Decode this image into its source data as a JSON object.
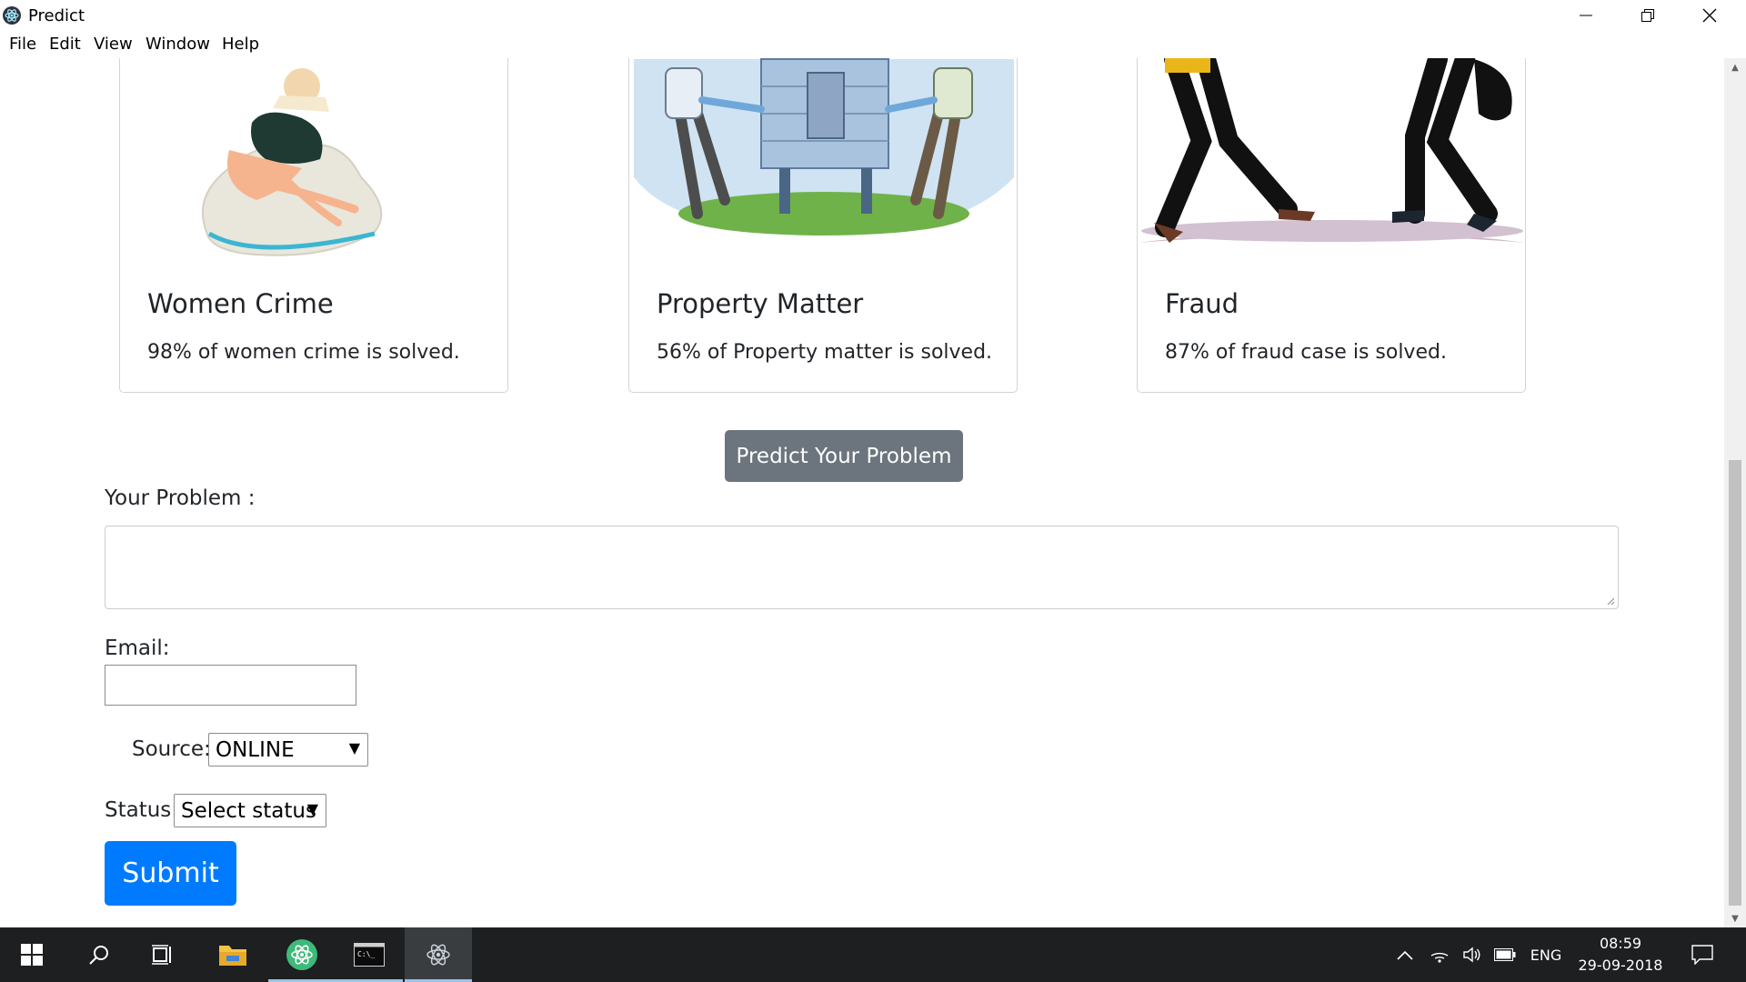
{
  "window": {
    "title": "Predict",
    "menu": [
      "File",
      "Edit",
      "View",
      "Window",
      "Help"
    ]
  },
  "cards": [
    {
      "title": "Women Crime",
      "text": "98% of women crime is solved."
    },
    {
      "title": "Property Matter",
      "text": "56% of Property matter is solved."
    },
    {
      "title": "Fraud",
      "text": "87% of fraud case is solved."
    }
  ],
  "predict_button": "Predict Your Problem",
  "form": {
    "problem_label": "Your Problem :",
    "problem_value": "",
    "email_label": "Email:",
    "email_value": "",
    "source_label": "Source:",
    "source_value": "ONLINE",
    "status_label": "Status:",
    "status_value": "Select status",
    "submit_label": "Submit"
  },
  "taskbar": {
    "language": "ENG",
    "time": "08:59",
    "date": "29-09-2018"
  },
  "colors": {
    "primary": "#007bff",
    "secondary": "#6c757d",
    "taskbar": "#1d1f21"
  },
  "icons": [
    "windows-start-icon",
    "search-icon",
    "task-view-icon",
    "file-explorer-icon",
    "atom-icon",
    "terminal-icon",
    "electron-icon",
    "chevron-up-icon",
    "wifi-icon",
    "volume-icon",
    "battery-icon",
    "notification-icon"
  ]
}
